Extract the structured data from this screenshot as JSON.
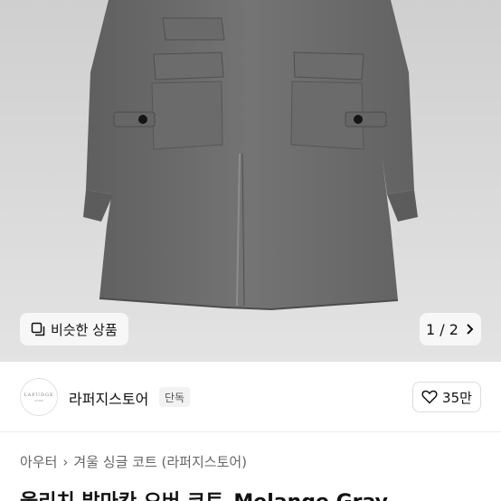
{
  "product_image": {
    "type": "gray-overcoat-photo"
  },
  "similar_button": {
    "label": "비슷한 상품",
    "icon": "similar-products-icon"
  },
  "pager": {
    "text": "1 / 2",
    "icon": "chevron-right-icon"
  },
  "seller": {
    "avatar_logo": "LAFUDGE",
    "avatar_sub": "STORE",
    "name": "라퍼지스토어",
    "badge": "단독",
    "like_icon": "heart-icon",
    "likes": "35만"
  },
  "breadcrumb": {
    "level1": "아우터",
    "separator": "›",
    "level2": "겨울 싱글 코트 (라퍼지스토어)"
  },
  "product_title": "울리치 발마칸 오버 코트_Melange Gray",
  "colors": {
    "coat": "#6f6f6f",
    "background": "#d3d3d3",
    "text": "#111111"
  }
}
